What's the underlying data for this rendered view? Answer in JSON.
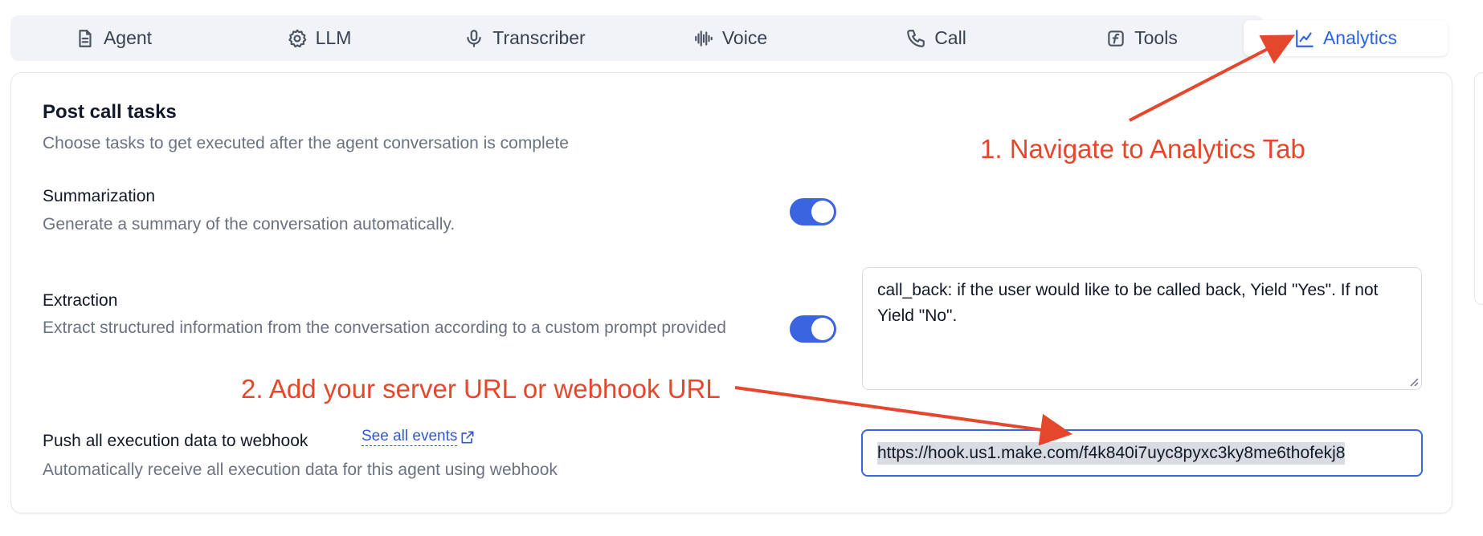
{
  "tabs": [
    {
      "label": "Agent",
      "icon": "document-icon",
      "active": false
    },
    {
      "label": "LLM",
      "icon": "cog-icon",
      "active": false
    },
    {
      "label": "Transcriber",
      "icon": "microphone-icon",
      "active": false
    },
    {
      "label": "Voice",
      "icon": "waveform-icon",
      "active": false
    },
    {
      "label": "Call",
      "icon": "phone-icon",
      "active": false
    },
    {
      "label": "Tools",
      "icon": "function-icon",
      "active": false
    },
    {
      "label": "Analytics",
      "icon": "chart-line-icon",
      "active": true
    }
  ],
  "section": {
    "title": "Post call tasks",
    "subtitle": "Choose tasks to get executed after the agent conversation is complete"
  },
  "summarization": {
    "label": "Summarization",
    "description": "Generate a summary of the conversation automatically.",
    "enabled": true
  },
  "extraction": {
    "label": "Extraction",
    "description": "Extract structured information from the conversation according to a custom prompt provided",
    "enabled": true,
    "prompt_value": "call_back: if the user would like to be called back, Yield \"Yes\". If not Yield \"No\"."
  },
  "webhook": {
    "label": "Push all execution data to webhook",
    "link_text": "See all events",
    "description": "Automatically receive all execution data for this agent using webhook",
    "url_value": "https://hook.us1.make.com/f4k840i7uyc8pyxc3ky8me6thofekj8"
  },
  "annotations": {
    "step1": "1. Navigate to Analytics Tab",
    "step2": "2. Add your server URL or webhook URL",
    "color": "#e5472c"
  },
  "colors": {
    "accent": "#3b64e0",
    "tab_active_text": "#2f63e0"
  }
}
